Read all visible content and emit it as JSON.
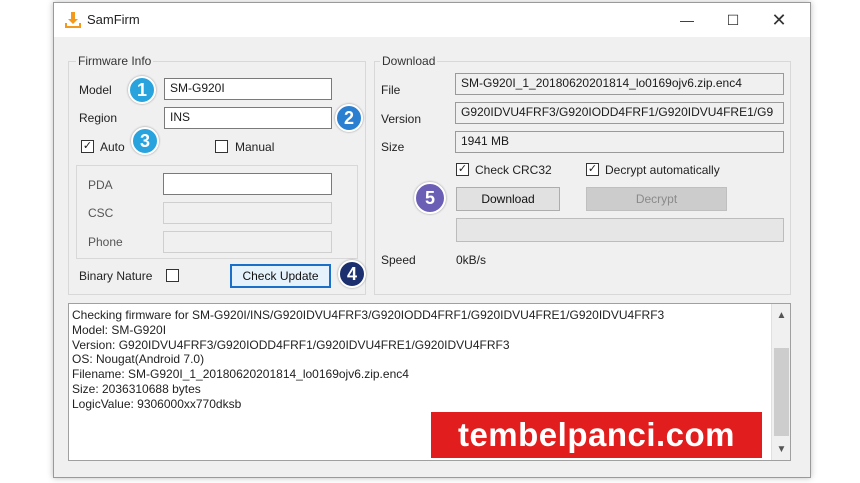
{
  "window": {
    "title": "SamFirm"
  },
  "firmware_info": {
    "group_label": "Firmware Info",
    "model_label": "Model",
    "model_value": "SM-G920I",
    "region_label": "Region",
    "region_value": "INS",
    "auto_label": "Auto",
    "auto_checked": true,
    "manual_label": "Manual",
    "manual_checked": false,
    "pda_label": "PDA",
    "csc_label": "CSC",
    "phone_label": "Phone",
    "binary_nature_label": "Binary Nature",
    "check_update_label": "Check Update"
  },
  "download": {
    "group_label": "Download",
    "file_label": "File",
    "file_value": "SM-G920I_1_20180620201814_lo0169ojv6.zip.enc4",
    "version_label": "Version",
    "version_value": "G920IDVU4FRF3/G920IODD4FRF1/G920IDVU4FRE1/G9",
    "size_label": "Size",
    "size_value": "1941 MB",
    "check_crc_label": "Check CRC32",
    "decrypt_auto_label": "Decrypt automatically",
    "download_button": "Download",
    "decrypt_button": "Decrypt",
    "speed_label": "Speed",
    "speed_value": "0kB/s"
  },
  "badges": [
    "1",
    "2",
    "3",
    "4",
    "5"
  ],
  "log": [
    "Checking firmware for SM-G920I/INS/G920IDVU4FRF3/G920IODD4FRF1/G920IDVU4FRE1/G920IDVU4FRF3",
    "Model: SM-G920I",
    "Version: G920IDVU4FRF3/G920IODD4FRF1/G920IDVU4FRE1/G920IDVU4FRF3",
    "OS: Nougat(Android 7.0)",
    "Filename: SM-G920I_1_20180620201814_lo0169ojv6.zip.enc4",
    "Size: 2036310688 bytes",
    "LogicValue: 9306000xx770dksb"
  ],
  "watermark": "tembelpanci.com",
  "colors": {
    "badge_cyan": "#29a3dd",
    "badge_blue": "#2b7fd1",
    "badge_navy": "#1c2f6e",
    "badge_purple": "#6b5fb5",
    "watermark_red": "#e21d1d"
  }
}
